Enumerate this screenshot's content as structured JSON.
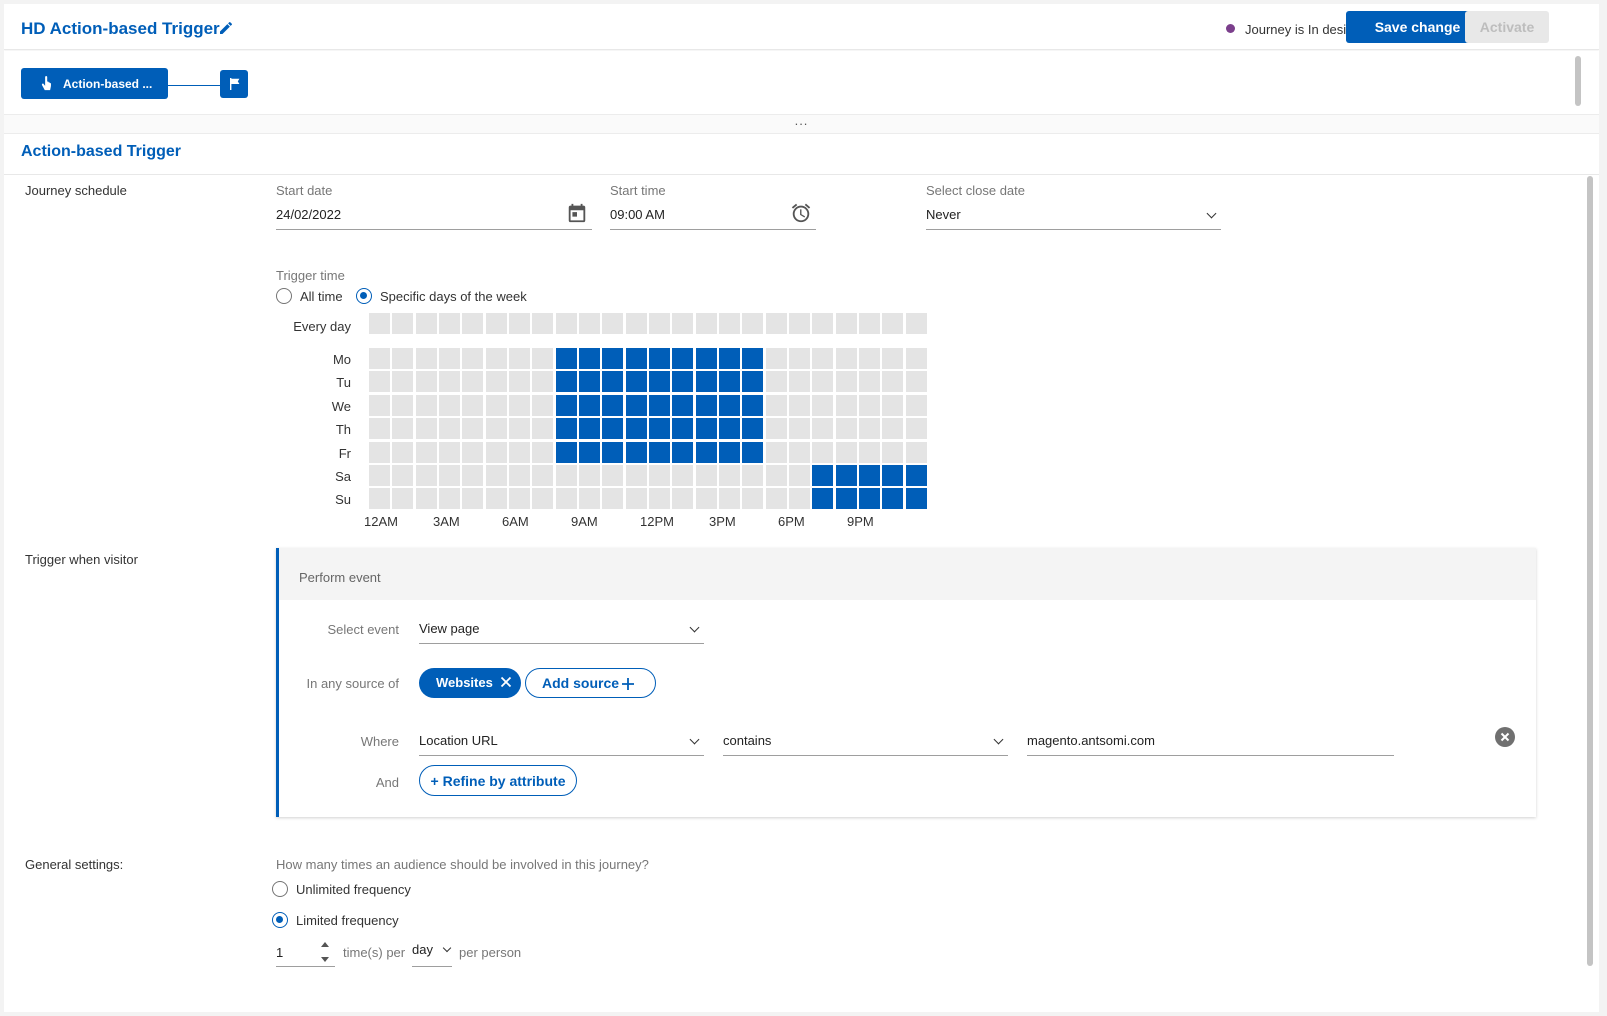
{
  "header": {
    "title": "HD Action-based Trigger",
    "status": "Journey is In design",
    "status_color": "#7b3f8c",
    "save_label": "Save change",
    "activate_label": "Activate",
    "accent": "#005eb8"
  },
  "flow": {
    "node_label": "Action-based ...",
    "resizer": "..."
  },
  "section": {
    "title": "Action-based Trigger"
  },
  "schedule": {
    "row_label": "Journey schedule",
    "start_date_label": "Start date",
    "start_date_value": "24/02/2022",
    "start_time_label": "Start time",
    "start_time_value": "09:00 AM",
    "close_date_label": "Select close date",
    "close_date_value": "Never",
    "trigger_time_label": "Trigger time",
    "option_all_time": "All time",
    "option_specific": "Specific days of the week",
    "selected_option": "Specific days of the week",
    "every_day_label": "Every day",
    "days": [
      "Mo",
      "Tu",
      "We",
      "Th",
      "Fr",
      "Sa",
      "Su"
    ],
    "hour_labels": [
      "12AM",
      "3AM",
      "6AM",
      "9AM",
      "12PM",
      "3PM",
      "6PM",
      "9PM"
    ],
    "selected_hours": {
      "Mo": [
        8,
        9,
        10,
        11,
        12,
        13,
        14,
        15,
        16
      ],
      "Tu": [
        8,
        9,
        10,
        11,
        12,
        13,
        14,
        15,
        16
      ],
      "We": [
        8,
        9,
        10,
        11,
        12,
        13,
        14,
        15,
        16
      ],
      "Th": [
        8,
        9,
        10,
        11,
        12,
        13,
        14,
        15,
        16
      ],
      "Fr": [
        8,
        9,
        10,
        11,
        12,
        13,
        14,
        15,
        16
      ],
      "Sa": [
        19,
        20,
        21,
        22,
        23
      ],
      "Su": [
        19,
        20,
        21,
        22,
        23
      ]
    }
  },
  "trigger": {
    "row_label": "Trigger when visitor",
    "panel_title": "Perform event",
    "select_event_label": "Select event",
    "select_event_value": "View page",
    "source_label": "In any source of",
    "source_chip": "Websites",
    "add_source_label": "Add source",
    "where_label": "Where",
    "where_attribute": "Location URL",
    "where_operator": "contains",
    "where_value": "magento.antsomi.com",
    "and_label": "And",
    "refine_label": "+ Refine by attribute"
  },
  "general": {
    "row_label": "General settings:",
    "question": "How many times an audience should be involved in this journey?",
    "option_unlimited": "Unlimited frequency",
    "option_limited": "Limited frequency",
    "selected_option": "Limited frequency",
    "times_value": "1",
    "times_per_label": "time(s) per",
    "period_value": "day",
    "per_person_label": "per person"
  }
}
